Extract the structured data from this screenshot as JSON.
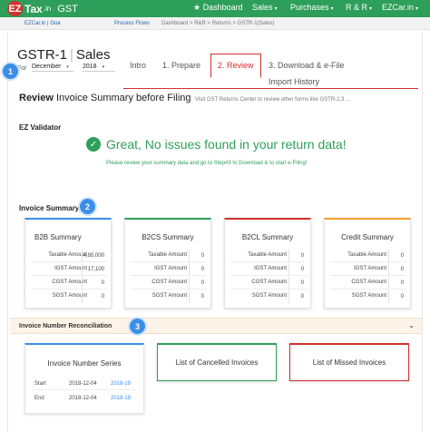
{
  "nav": {
    "logo_ez": "EZ",
    "logo_tax": "Tax",
    "logo_in": ".in",
    "logo_gst": "GST",
    "dashboard": "Dashboard",
    "sales": "Sales",
    "purchases": "Purchases",
    "rr": "R & R",
    "ezcar": "EZCar.in",
    "caret": "▾"
  },
  "crumb": {
    "account": "EZCar.in | Goa",
    "process_flows": "Process Flows",
    "path": "Dashboard > R&R > Returns > GSTR-1(Sales)"
  },
  "header": {
    "form": "GSTR-1",
    "divider": "|",
    "type": "Sales",
    "for_label": "For",
    "month": "December",
    "year": "2018"
  },
  "tabs": [
    "Intro",
    "1. Prepare",
    "2. Review",
    "3. Download & e-File",
    "Import History"
  ],
  "markers": [
    "1",
    "2",
    "3"
  ],
  "review": {
    "bold": "Review",
    "rest": "Invoice Summary before Filing",
    "note": "Visit GST Returns Center to review other forms like GSTR-2,3 ..."
  },
  "validator": {
    "title": "EZ Validator",
    "message": "Great, No issues found in your return data!",
    "sub": "Please review your summary data and go to Step#3 to Download & to start e-Filing!"
  },
  "invoice_summary": {
    "title": "Invoice Summary",
    "cards": [
      {
        "title": "B2B Summary",
        "rows": [
          {
            "label": "Taxable Amount",
            "value": "4,95,000"
          },
          {
            "label": "IGST Amount",
            "value": "17,100"
          },
          {
            "label": "CGST Amount",
            "value": "0"
          },
          {
            "label": "SGST Amount",
            "value": "0"
          }
        ]
      },
      {
        "title": "B2CS Summary",
        "rows": [
          {
            "label": "Taxable Amount",
            "value": "0"
          },
          {
            "label": "IGST Amount",
            "value": "0"
          },
          {
            "label": "CGST Amount",
            "value": "0"
          },
          {
            "label": "SGST Amount",
            "value": "0"
          }
        ]
      },
      {
        "title": "B2CL Summary",
        "rows": [
          {
            "label": "Taxable Amount",
            "value": "0"
          },
          {
            "label": "IGST Amount",
            "value": "0"
          },
          {
            "label": "CGST Amount",
            "value": "0"
          },
          {
            "label": "SGST Amount",
            "value": "0"
          }
        ]
      },
      {
        "title": "Credit Summary",
        "rows": [
          {
            "label": "Taxable Amount",
            "value": "0"
          },
          {
            "label": "IGST Amount",
            "value": "0"
          },
          {
            "label": "CGST Amount",
            "value": "0"
          },
          {
            "label": "SGST Amount",
            "value": "0"
          }
        ]
      }
    ]
  },
  "reconciliation": {
    "title": "Invoice Number Reconciliation",
    "series": {
      "title": "Invoice Number Series",
      "rows": [
        {
          "label": "Start",
          "date": "2018-12-04",
          "link": "2018-19"
        },
        {
          "label": "End",
          "date": "2018-12-04",
          "link": "2018-19"
        }
      ]
    },
    "cancelled": "List of Cancelled Invoices",
    "missed": "List of Missed Invoices"
  },
  "colors": {
    "brand_green": "#2e9f5a",
    "brand_red": "#d0312d",
    "marker_blue": "#3b8ee8",
    "b2b_border": "#3b8ee8",
    "b2cs_border": "#2e9f5a",
    "b2cl_border": "#d0312d",
    "credit_border": "#f0a030"
  }
}
